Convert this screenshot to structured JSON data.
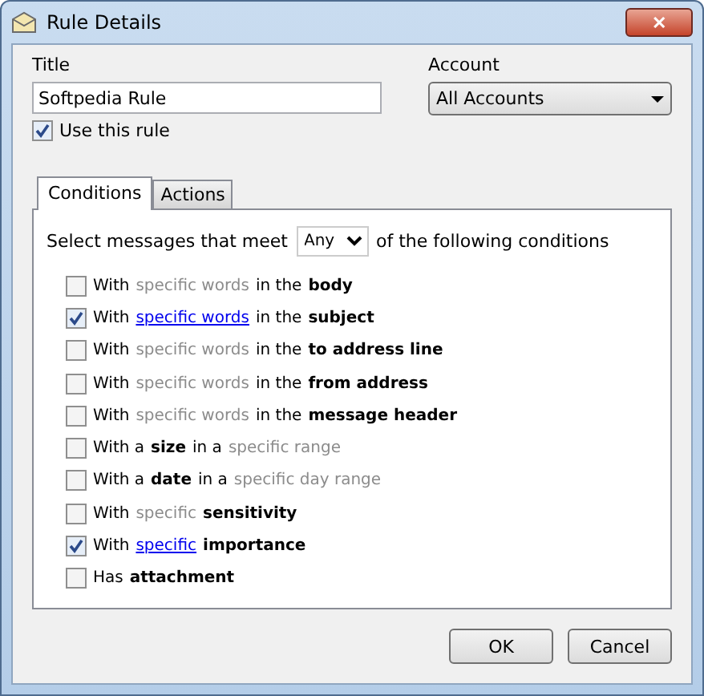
{
  "window": {
    "title": "Rule Details",
    "close": "✕"
  },
  "title_field": {
    "label": "Title",
    "value": "Softpedia Rule"
  },
  "account": {
    "label": "Account",
    "value": "All Accounts"
  },
  "use_rule": {
    "label": "Use this rule",
    "checked": true
  },
  "tabs": [
    {
      "label": "Conditions",
      "selected": true
    },
    {
      "label": "Actions",
      "selected": false
    }
  ],
  "match": {
    "before": "Select messages that meet",
    "value": "Any",
    "after": "of the following conditions"
  },
  "conditions": [
    {
      "checked": false,
      "parts": [
        {
          "kind": "plain",
          "text": "With"
        },
        {
          "kind": "variable",
          "text": "specific words"
        },
        {
          "kind": "plain",
          "text": "in the"
        },
        {
          "kind": "bold",
          "text": "body"
        }
      ]
    },
    {
      "checked": true,
      "parts": [
        {
          "kind": "plain",
          "text": "With"
        },
        {
          "kind": "variable",
          "text": "specific words"
        },
        {
          "kind": "plain",
          "text": "in the"
        },
        {
          "kind": "bold",
          "text": "subject"
        }
      ]
    },
    {
      "checked": false,
      "parts": [
        {
          "kind": "plain",
          "text": "With"
        },
        {
          "kind": "variable",
          "text": "specific words"
        },
        {
          "kind": "plain",
          "text": "in the"
        },
        {
          "kind": "bold",
          "text": "to address line"
        }
      ]
    },
    {
      "checked": false,
      "parts": [
        {
          "kind": "plain",
          "text": "With"
        },
        {
          "kind": "variable",
          "text": "specific words"
        },
        {
          "kind": "plain",
          "text": "in the"
        },
        {
          "kind": "bold",
          "text": "from address"
        }
      ]
    },
    {
      "checked": false,
      "parts": [
        {
          "kind": "plain",
          "text": "With"
        },
        {
          "kind": "variable",
          "text": "specific words"
        },
        {
          "kind": "plain",
          "text": "in the"
        },
        {
          "kind": "bold",
          "text": "message header"
        }
      ]
    },
    {
      "checked": false,
      "parts": [
        {
          "kind": "plain",
          "text": "With a"
        },
        {
          "kind": "bold",
          "text": "size"
        },
        {
          "kind": "plain",
          "text": "in a"
        },
        {
          "kind": "variable",
          "text": "specific range"
        }
      ]
    },
    {
      "checked": false,
      "parts": [
        {
          "kind": "plain",
          "text": "With a"
        },
        {
          "kind": "bold",
          "text": "date"
        },
        {
          "kind": "plain",
          "text": "in a"
        },
        {
          "kind": "variable",
          "text": "specific day range"
        }
      ]
    },
    {
      "checked": false,
      "parts": [
        {
          "kind": "plain",
          "text": "With"
        },
        {
          "kind": "variable",
          "text": "specific"
        },
        {
          "kind": "bold",
          "text": "sensitivity"
        }
      ]
    },
    {
      "checked": true,
      "parts": [
        {
          "kind": "plain",
          "text": "With"
        },
        {
          "kind": "variable",
          "text": "specific"
        },
        {
          "kind": "bold",
          "text": "importance"
        }
      ]
    },
    {
      "checked": false,
      "parts": [
        {
          "kind": "plain",
          "text": "Has"
        },
        {
          "kind": "bold",
          "text": "attachment"
        }
      ]
    }
  ],
  "buttons": [
    "OK",
    "Cancel"
  ]
}
